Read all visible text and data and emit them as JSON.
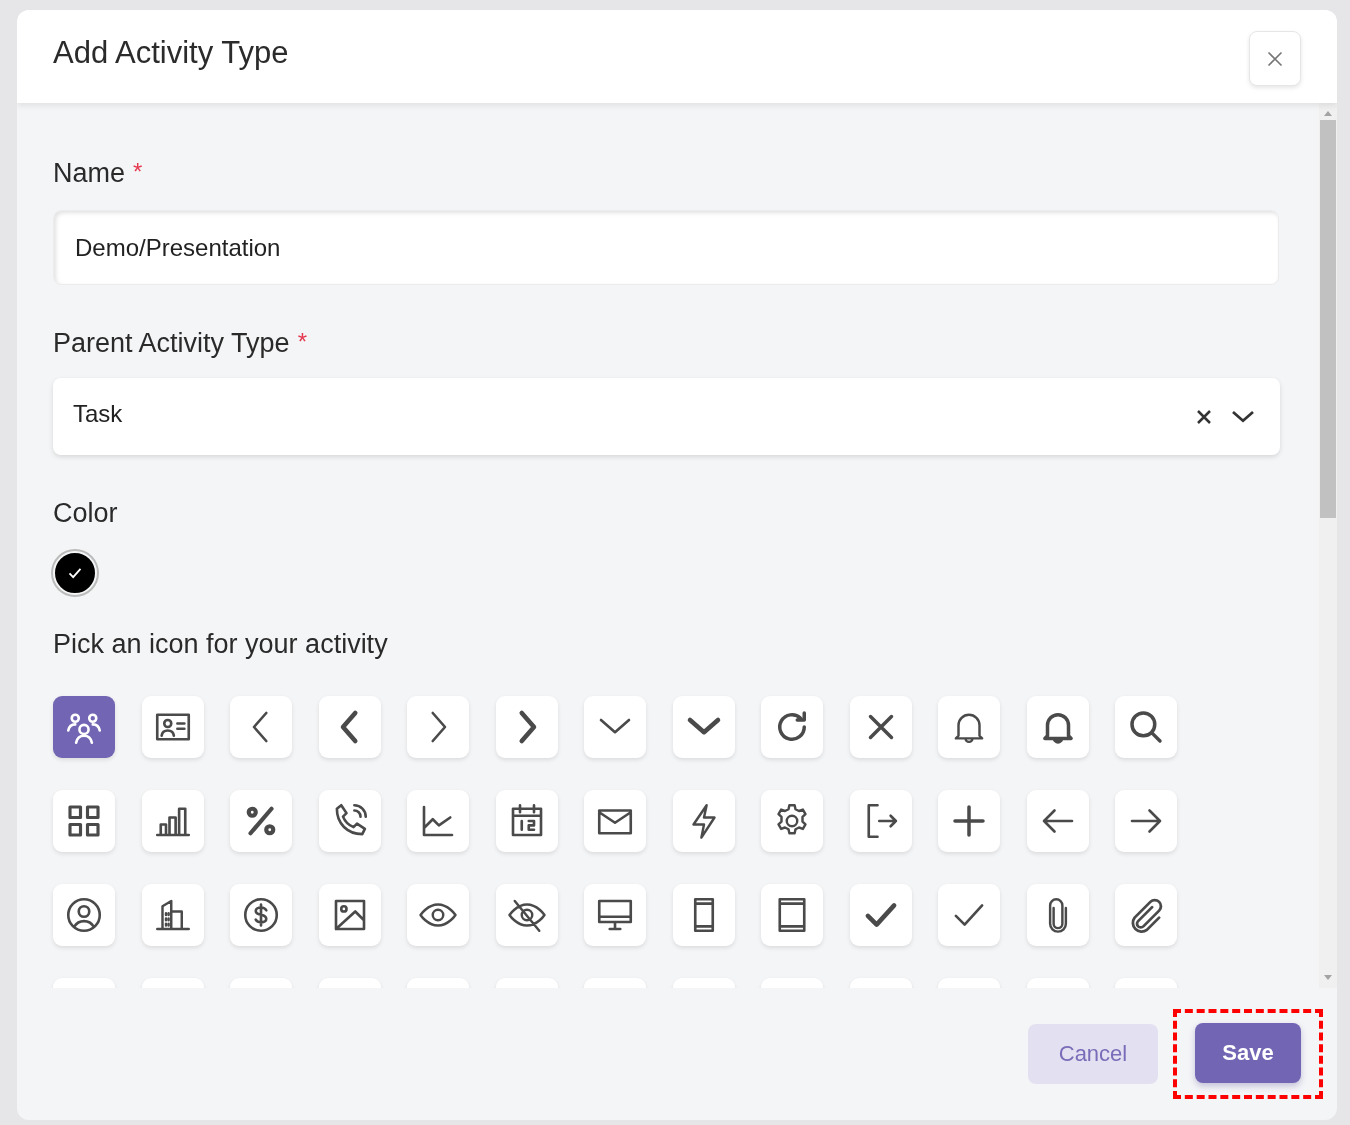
{
  "dialog": {
    "title": "Add Activity Type"
  },
  "name_field": {
    "label": "Name",
    "required_mark": "*",
    "value": "Demo/Presentation"
  },
  "parent_field": {
    "label": "Parent Activity Type",
    "required_mark": "*",
    "value": "Task"
  },
  "color_section": {
    "label": "Color",
    "swatches": [
      {
        "color": "#000000",
        "selected": true
      }
    ]
  },
  "icon_section": {
    "label": "Pick an icon for your activity",
    "icons": [
      {
        "kind": "people",
        "selected": true
      },
      {
        "kind": "contact-card",
        "selected": false
      },
      {
        "kind": "chevron-left",
        "selected": false
      },
      {
        "kind": "chevron-left-bold",
        "selected": false
      },
      {
        "kind": "chevron-right",
        "selected": false
      },
      {
        "kind": "chevron-right-bold",
        "selected": false
      },
      {
        "kind": "chevron-down",
        "selected": false
      },
      {
        "kind": "chevron-down-bold",
        "selected": false
      },
      {
        "kind": "refresh",
        "selected": false
      },
      {
        "kind": "close",
        "selected": false
      },
      {
        "kind": "bell",
        "selected": false
      },
      {
        "kind": "bell-bold",
        "selected": false
      },
      {
        "kind": "search",
        "selected": false
      },
      {
        "kind": "grid",
        "selected": false
      },
      {
        "kind": "bar-chart",
        "selected": false
      },
      {
        "kind": "percent",
        "selected": false
      },
      {
        "kind": "phone-call",
        "selected": false
      },
      {
        "kind": "line-chart",
        "selected": false
      },
      {
        "kind": "calendar",
        "selected": false
      },
      {
        "kind": "mail",
        "selected": false
      },
      {
        "kind": "bolt",
        "selected": false
      },
      {
        "kind": "gear",
        "selected": false
      },
      {
        "kind": "logout",
        "selected": false
      },
      {
        "kind": "plus",
        "selected": false
      },
      {
        "kind": "arrow-left",
        "selected": false
      },
      {
        "kind": "arrow-right",
        "selected": false
      },
      {
        "kind": "user-circle",
        "selected": false
      },
      {
        "kind": "buildings",
        "selected": false
      },
      {
        "kind": "dollar-circle",
        "selected": false
      },
      {
        "kind": "image",
        "selected": false
      },
      {
        "kind": "eye",
        "selected": false
      },
      {
        "kind": "eye-off",
        "selected": false
      },
      {
        "kind": "monitor",
        "selected": false
      },
      {
        "kind": "smartphone",
        "selected": false
      },
      {
        "kind": "tablet",
        "selected": false
      },
      {
        "kind": "check-bold",
        "selected": false
      },
      {
        "kind": "check",
        "selected": false
      },
      {
        "kind": "paperclip",
        "selected": false
      },
      {
        "kind": "paperclip-diagonal",
        "selected": false
      }
    ]
  },
  "footer": {
    "buttons": [
      {
        "kind": "secondary",
        "label": "Cancel",
        "highlighted": false
      },
      {
        "kind": "primary",
        "label": "Save",
        "highlighted": true
      }
    ]
  }
}
